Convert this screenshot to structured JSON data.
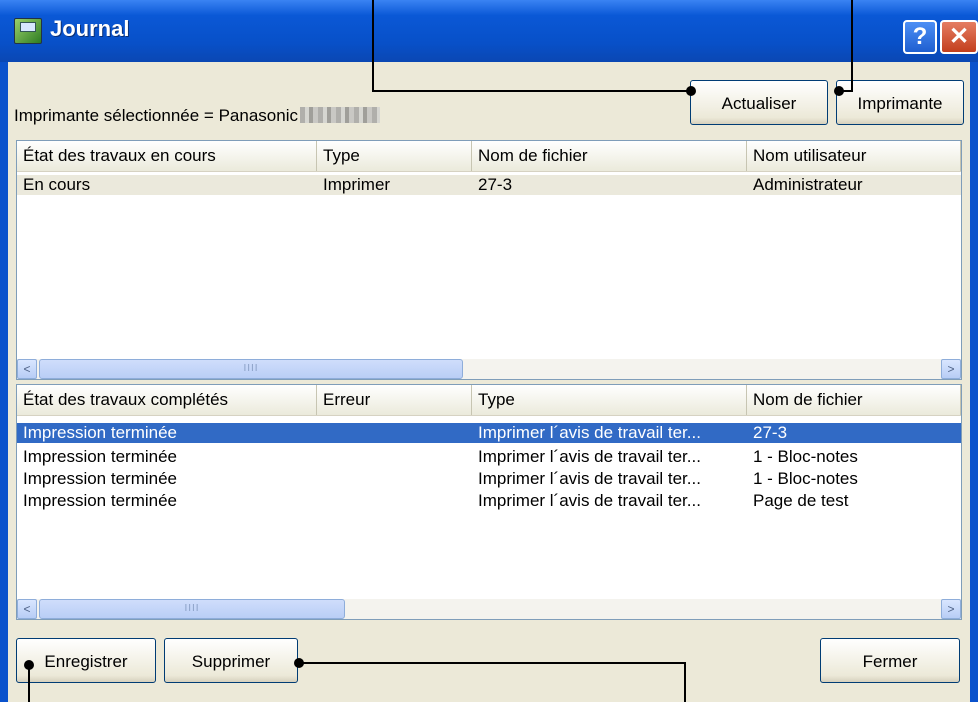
{
  "window": {
    "title": "Journal",
    "help_label": "?",
    "close_label": "✕"
  },
  "printer": {
    "label": "Imprimante sélectionnée = Panasonic"
  },
  "buttons": {
    "refresh": "Actualiser",
    "printer": "Imprimante",
    "save": "Enregistrer",
    "delete": "Supprimer",
    "close": "Fermer"
  },
  "current_jobs": {
    "columns": [
      "État des travaux en cours",
      "Type",
      "Nom de fichier",
      "Nom utilisateur"
    ],
    "rows": [
      [
        "En cours",
        "Imprimer",
        "27-3",
        "Administrateur"
      ]
    ]
  },
  "completed_jobs": {
    "columns": [
      "État des travaux complétés",
      "Erreur",
      "Type",
      "Nom de fichier"
    ],
    "rows": [
      [
        "Impression terminée",
        "",
        "Imprimer l´avis de travail ter...",
        "27-3"
      ],
      [
        "Impression terminée",
        "",
        "Imprimer l´avis de travail ter...",
        "1 - Bloc-notes"
      ],
      [
        "Impression terminée",
        "",
        "Imprimer l´avis de travail ter...",
        "1 - Bloc-notes"
      ],
      [
        "Impression terminée",
        "",
        "Imprimer l´avis de travail ter...",
        "Page de test"
      ]
    ],
    "selected_row": 0
  },
  "scrollbar": {
    "left_arrow": "<",
    "right_arrow": ">",
    "grip": "IIII"
  },
  "colors": {
    "titlebar": "#0a58d6",
    "selection": "#316ac5",
    "dialog_bg": "#ece9d8"
  }
}
